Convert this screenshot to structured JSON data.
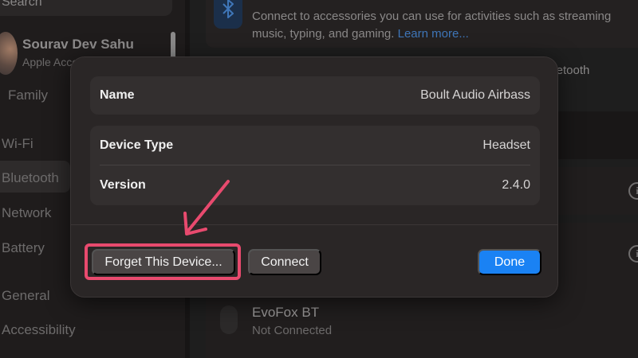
{
  "sidebar": {
    "search_placeholder": "Search",
    "profile_name": "Sourav Dev Sahu",
    "profile_sub": "Apple Acco",
    "family": "Family",
    "items": [
      "Wi-Fi",
      "Bluetooth",
      "Network",
      "Battery",
      "General",
      "Accessibility"
    ],
    "selected": "Bluetooth"
  },
  "main": {
    "bluetooth_description": "Connect to accessories you can use for activities such as streaming music, typing, and gaming.",
    "learn_more": "Learn more...",
    "bluetooth_label": "luetooth",
    "devices": [
      {
        "name": "EvoFox BT",
        "status": "Not Connected"
      }
    ]
  },
  "sheet": {
    "name_label": "Name",
    "name_value": "Boult Audio Airbass",
    "device_type_label": "Device Type",
    "device_type_value": "Headset",
    "version_label": "Version",
    "version_value": "2.4.0",
    "forget_button": "Forget This Device...",
    "connect_button": "Connect",
    "done_button": "Done"
  },
  "colors": {
    "accent": "#1a82f4",
    "highlight": "#e84a6e"
  }
}
